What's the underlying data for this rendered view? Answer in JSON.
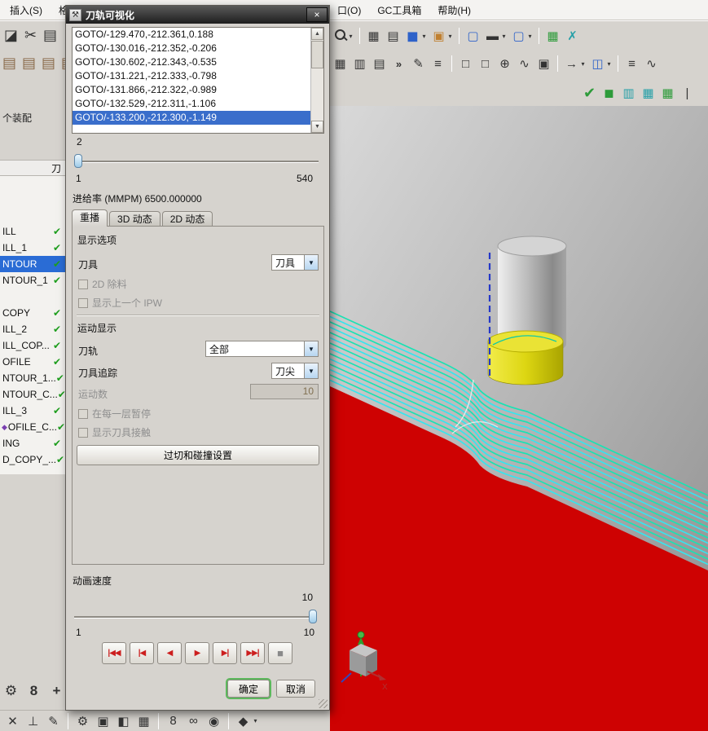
{
  "menu": {
    "left": [
      "插入(S)",
      "格"
    ],
    "right": [
      "口(O)",
      "GC工具箱",
      "帮助(H)"
    ]
  },
  "assembly_label": "个装配",
  "navigator": {
    "header": "刀",
    "rows": [
      {
        "text": "ILL",
        "check": "✔"
      },
      {
        "text": "ILL_1",
        "check": "✔"
      },
      {
        "text": "NTOUR",
        "check": "✔",
        "cls": "selected"
      },
      {
        "text": "NTOUR_1",
        "check": "✔"
      },
      {
        "text": "",
        "check": ""
      },
      {
        "text": "COPY",
        "check": "✔"
      },
      {
        "text": "ILL_2",
        "check": "✔"
      },
      {
        "text": "ILL_COP...",
        "check": "✔"
      },
      {
        "text": "OFILE",
        "check": "✔"
      },
      {
        "text": "NTOUR_1...",
        "check": "✔"
      },
      {
        "text": "NTOUR_C...",
        "check": "✔"
      },
      {
        "text": "ILL_3",
        "check": "✔"
      },
      {
        "text": "OFILE_C...",
        "check": "✔",
        "pre": "◆",
        "precls": "purple"
      },
      {
        "text": "ING",
        "check": "✔"
      },
      {
        "text": "D_COPY_...",
        "check": "✔"
      }
    ]
  },
  "dialog": {
    "title": "刀轨可视化",
    "goto_lines": [
      {
        "text": "GOTO/-129.470,-212.361,0.188"
      },
      {
        "text": "GOTO/-130.016,-212.352,-0.206"
      },
      {
        "text": "GOTO/-130.602,-212.343,-0.535"
      },
      {
        "text": "GOTO/-131.221,-212.333,-0.798"
      },
      {
        "text": "GOTO/-131.866,-212.322,-0.989"
      },
      {
        "text": "GOTO/-132.529,-212.311,-1.106"
      },
      {
        "text": "GOTO/-133.200,-212.300,-1.149",
        "cls": "selected"
      }
    ],
    "progress": {
      "current": "2",
      "min": "1",
      "max": "540"
    },
    "feedrate_label": "进给率 (MMPM) 6500.000000",
    "tabs": [
      {
        "label": "重播",
        "cls": "active"
      },
      {
        "label": "3D 动态"
      },
      {
        "label": "2D 动态"
      }
    ],
    "display": {
      "heading": "显示选项",
      "tool_label": "刀具",
      "tool_value": "刀具",
      "cb_2d_label": "2D 除料",
      "cb_ipw_label": "显示上一个 IPW"
    },
    "motion": {
      "heading": "运动显示",
      "path_label": "刀轨",
      "path_value": "全部",
      "trace_label": "刀具追踪",
      "trace_value": "刀尖",
      "count_label": "运动数",
      "count_value": "10",
      "cb_pause_label": "在每一层暂停",
      "cb_contact_label": "显示刀具接触",
      "gouge_button_label": "过切和碰撞设置"
    },
    "speed": {
      "label": "动画速度",
      "value": "10",
      "min": "1",
      "max": "10"
    },
    "playback": [
      {
        "g": "|◀◀",
        "c": "red"
      },
      {
        "g": "|◀",
        "c": "red"
      },
      {
        "g": "◀",
        "c": "red"
      },
      {
        "g": "▶",
        "c": "red"
      },
      {
        "g": "▶|",
        "c": "red"
      },
      {
        "g": "▶▶|",
        "c": "red"
      },
      {
        "g": "■",
        "c": "gray"
      }
    ],
    "ok_label": "确定",
    "cancel_label": "取消"
  },
  "viewport": {
    "axis_x_label": "X"
  },
  "icons": {
    "dropdown": "▼",
    "close": "×",
    "dialog_glyph": "⚒"
  },
  "toolbars": {
    "left_row1": [
      {
        "g": "◪",
        "c": "dark lg"
      },
      {
        "g": "✂",
        "c": "dark lg"
      },
      {
        "g": "▤",
        "c": "dark lg"
      }
    ],
    "left_row2": [
      {
        "g": "▤",
        "c": "brown lg"
      },
      {
        "g": "▤",
        "c": "brown lg"
      },
      {
        "g": "▤",
        "c": "brown lg"
      },
      {
        "g": "▤",
        "c": "brown lg"
      }
    ],
    "right_row1": [
      {
        "g": "▾",
        "c": "ddg"
      },
      {
        "c": "sep"
      },
      {
        "g": "▦",
        "c": "dark"
      },
      {
        "g": "▤",
        "c": "dark"
      },
      {
        "g": "◼",
        "c": "blue lg"
      },
      {
        "g": "▾",
        "c": "ddg"
      },
      {
        "g": "▣",
        "c": "orange"
      },
      {
        "g": "▾",
        "c": "ddg"
      },
      {
        "c": "sep"
      },
      {
        "g": "▢",
        "c": "blue"
      },
      {
        "g": "▬",
        "c": "dark"
      },
      {
        "g": "▾",
        "c": "ddg"
      },
      {
        "g": "▢",
        "c": "blue"
      },
      {
        "g": "▾",
        "c": "ddg"
      },
      {
        "c": "sep"
      },
      {
        "g": "▦",
        "c": "green"
      },
      {
        "g": "✗",
        "c": "teal"
      }
    ],
    "right_row2": [
      {
        "g": "▦",
        "c": "dark"
      },
      {
        "g": "▥",
        "c": "dark"
      },
      {
        "g": "▤",
        "c": "dark"
      },
      {
        "g": "»",
        "c": "dark chev"
      },
      {
        "g": "✎",
        "c": "dark"
      },
      {
        "g": "≡",
        "c": "dark"
      },
      {
        "c": "sep"
      },
      {
        "g": "□",
        "c": "dark"
      },
      {
        "g": "□",
        "c": "dark"
      },
      {
        "g": "⊕",
        "c": "dark"
      },
      {
        "g": "∿",
        "c": "dark"
      },
      {
        "g": "▣",
        "c": "dark"
      },
      {
        "c": "sep"
      },
      {
        "g": "→",
        "c": "dark"
      },
      {
        "g": "▾",
        "c": "ddg"
      },
      {
        "g": "◫",
        "c": "blue"
      },
      {
        "g": "▾",
        "c": "ddg"
      },
      {
        "c": "sep"
      },
      {
        "g": "≡",
        "c": "dark"
      },
      {
        "g": "∿",
        "c": "dark"
      }
    ],
    "right_row3": [
      {
        "g": "✔",
        "c": "green lg"
      },
      {
        "g": "◼",
        "c": "green"
      },
      {
        "g": "▥",
        "c": "teal"
      },
      {
        "g": "▦",
        "c": "teal"
      },
      {
        "g": "▦",
        "c": "green"
      },
      {
        "g": "|",
        "c": "dark"
      }
    ],
    "sidebar_bottom": [
      {
        "g": "⚙",
        "c": "dark"
      },
      {
        "g": "8",
        "c": "dark"
      },
      {
        "g": "+",
        "c": "dark"
      }
    ],
    "bottom": [
      {
        "g": "✕",
        "c": "dark"
      },
      {
        "g": "⊥",
        "c": "dark"
      },
      {
        "g": "✎",
        "c": "dark"
      },
      {
        "c": "sep"
      },
      {
        "g": "⚙",
        "c": "dark"
      },
      {
        "g": "▣",
        "c": "dark"
      },
      {
        "g": "◧",
        "c": "dark"
      },
      {
        "g": "▦",
        "c": "dark"
      },
      {
        "c": "sep"
      },
      {
        "g": "8",
        "c": "dark"
      },
      {
        "g": "∞",
        "c": "dark"
      },
      {
        "g": "◉",
        "c": "dark"
      },
      {
        "c": "sep"
      },
      {
        "g": "◆",
        "c": "dark"
      },
      {
        "g": "▾",
        "c": "ddg"
      }
    ]
  },
  "colors": {
    "selection_blue": "#2a6cd5",
    "toolpath_cyan": "#35e6ee",
    "toolpath_green": "#19e2b4",
    "stock_red": "#ce0202",
    "tool_yellow": "#e9e432",
    "check_green": "#1d9e1d"
  }
}
